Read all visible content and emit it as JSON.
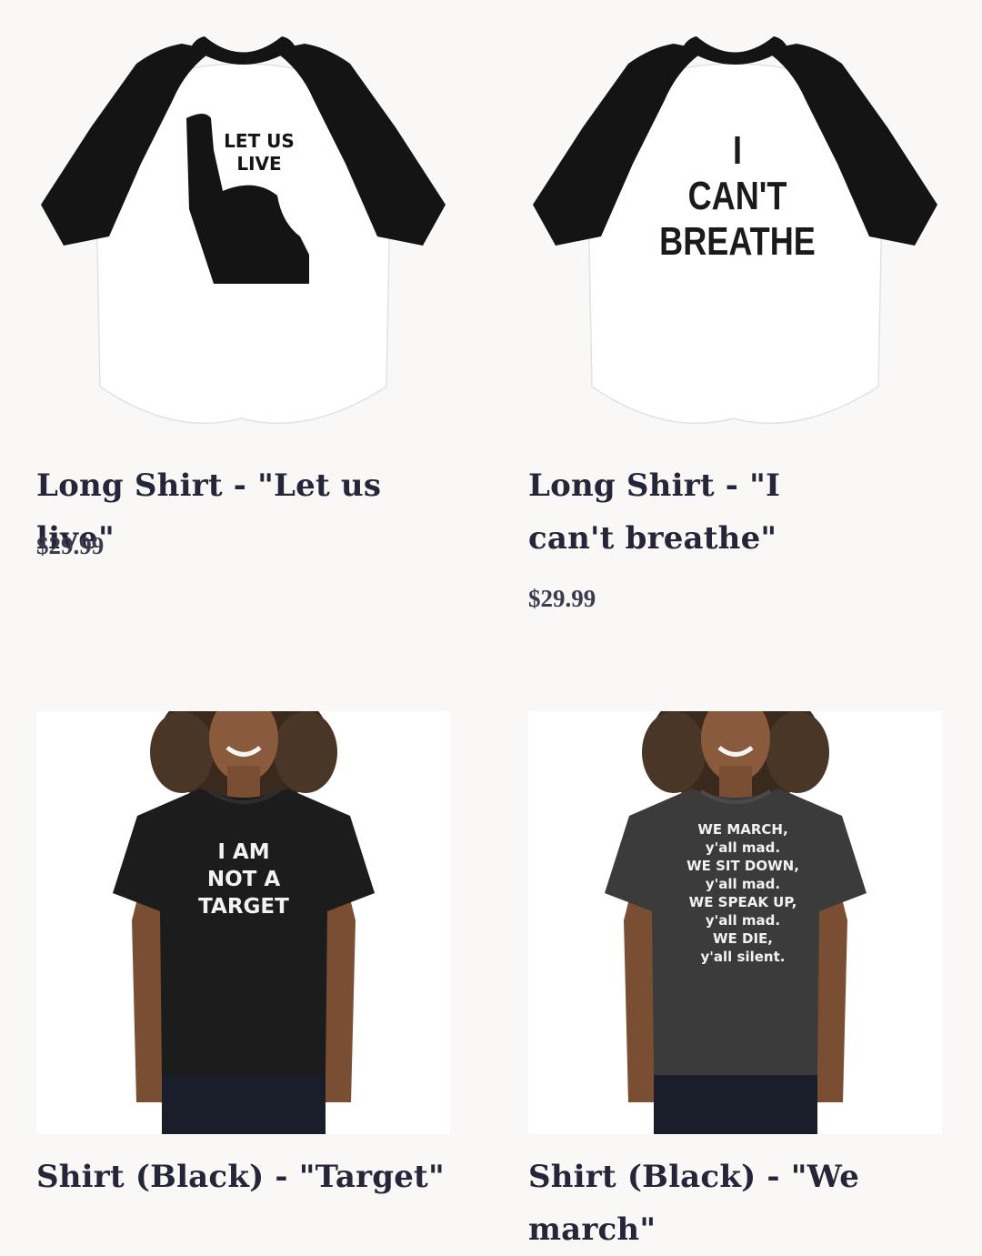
{
  "products": [
    {
      "title": "Long Shirt - \"Let us live\"",
      "price": "$29.99",
      "print_lines": [
        "LET US",
        "LIVE"
      ]
    },
    {
      "title": "Long Shirt - \"I can't breathe\"",
      "price": "$29.99",
      "print_lines": [
        "I",
        "CAN'T",
        "BREATHE"
      ]
    },
    {
      "title": "Shirt (Black) - \"Target\"",
      "print_lines": [
        "I AM",
        "NOT A",
        "TARGET"
      ]
    },
    {
      "title": "Shirt (Black) - \"We march\"",
      "print_lines": [
        "WE MARCH,",
        "y'all mad.",
        "WE SIT DOWN,",
        "y'all mad.",
        "WE SPEAK UP,",
        "y'all mad.",
        "WE DIE,",
        "y'all silent."
      ]
    }
  ],
  "colors": {
    "background": "#f9f8f6",
    "title_text": "#25263a",
    "raglan_sleeve": "#141414",
    "tee_black": "#1c1c1c",
    "tee_charcoal": "#3b3b3b"
  }
}
